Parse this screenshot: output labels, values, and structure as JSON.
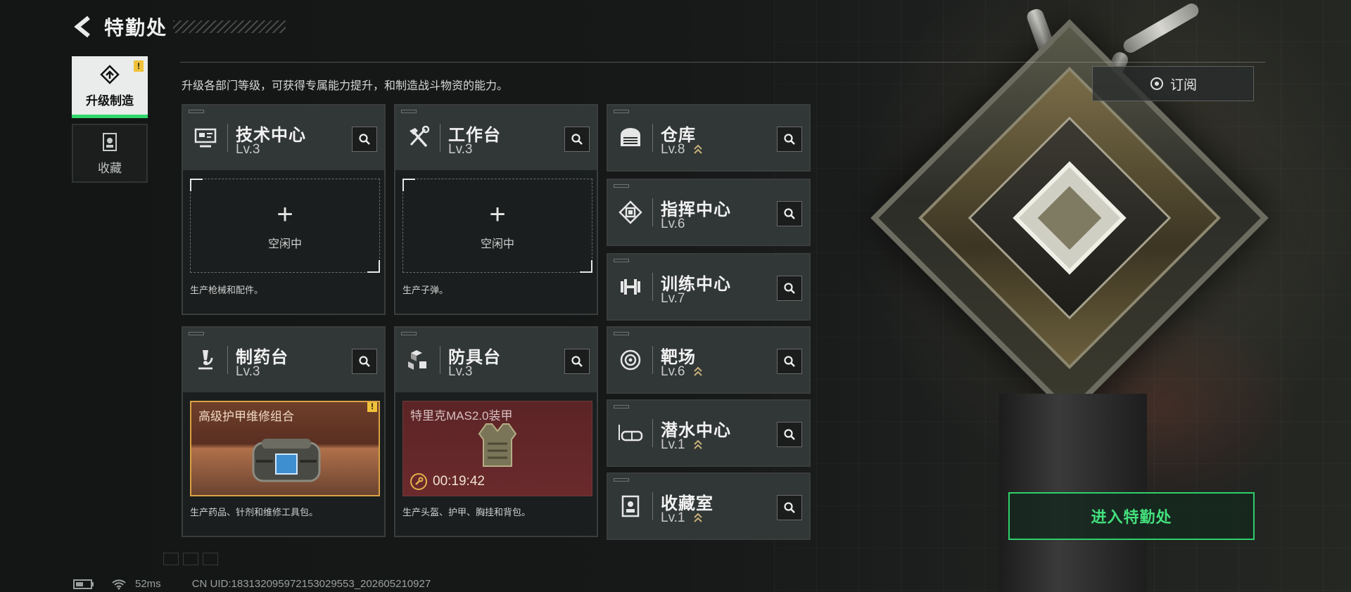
{
  "header": {
    "title": "特勤处"
  },
  "nav": {
    "items": [
      {
        "label": "升级制造",
        "active": true,
        "badge": "!"
      },
      {
        "label": "收藏",
        "active": false
      }
    ]
  },
  "main": {
    "description": "升级各部门等级，可获得专属能力提升，和制造战斗物资的能力。",
    "subscribe_label": "订阅",
    "enter_label": "进入特勤处"
  },
  "departments": [
    {
      "name": "技术中心",
      "level": "Lv.3",
      "icon": "monitor-icon",
      "status": "空闲中",
      "footer": "生产枪械和配件。"
    },
    {
      "name": "工作台",
      "level": "Lv.3",
      "icon": "hammer-wrench-icon",
      "status": "空闲中",
      "footer": "生产子弹。"
    },
    {
      "name": "制药台",
      "level": "Lv.3",
      "icon": "microscope-icon",
      "product": "高级护甲维修组合",
      "product_badge": "!",
      "footer": "生产药品、针剂和维修工具包。"
    },
    {
      "name": "防具台",
      "level": "Lv.3",
      "icon": "cubes-icon",
      "product": "特里克MAS2.0装甲",
      "timer": "00:19:42",
      "footer": "生产头盔、护甲、胸挂和背包。"
    },
    {
      "name": "仓库",
      "level": "Lv.8",
      "icon": "warehouse-icon"
    },
    {
      "name": "指挥中心",
      "level": "Lv.6",
      "icon": "chip-icon"
    },
    {
      "name": "训练中心",
      "level": "Lv.7",
      "icon": "dumbbell-icon"
    },
    {
      "name": "靶场",
      "level": "Lv.6",
      "icon": "target-icon"
    },
    {
      "name": "潜水中心",
      "level": "Lv.1",
      "icon": "diving-mask-icon"
    },
    {
      "name": "收藏室",
      "level": "Lv.1",
      "icon": "trophy-room-icon"
    }
  ],
  "footer": {
    "ping": "52ms",
    "uid": "CN UID:18313209597215302955​3_202605210927"
  },
  "colors": {
    "accent_green": "#2fcf6a",
    "warning_yellow": "#f0c23a",
    "upgrade_arrow": "#c9b27a",
    "timer_gold": "#e2b24a"
  }
}
